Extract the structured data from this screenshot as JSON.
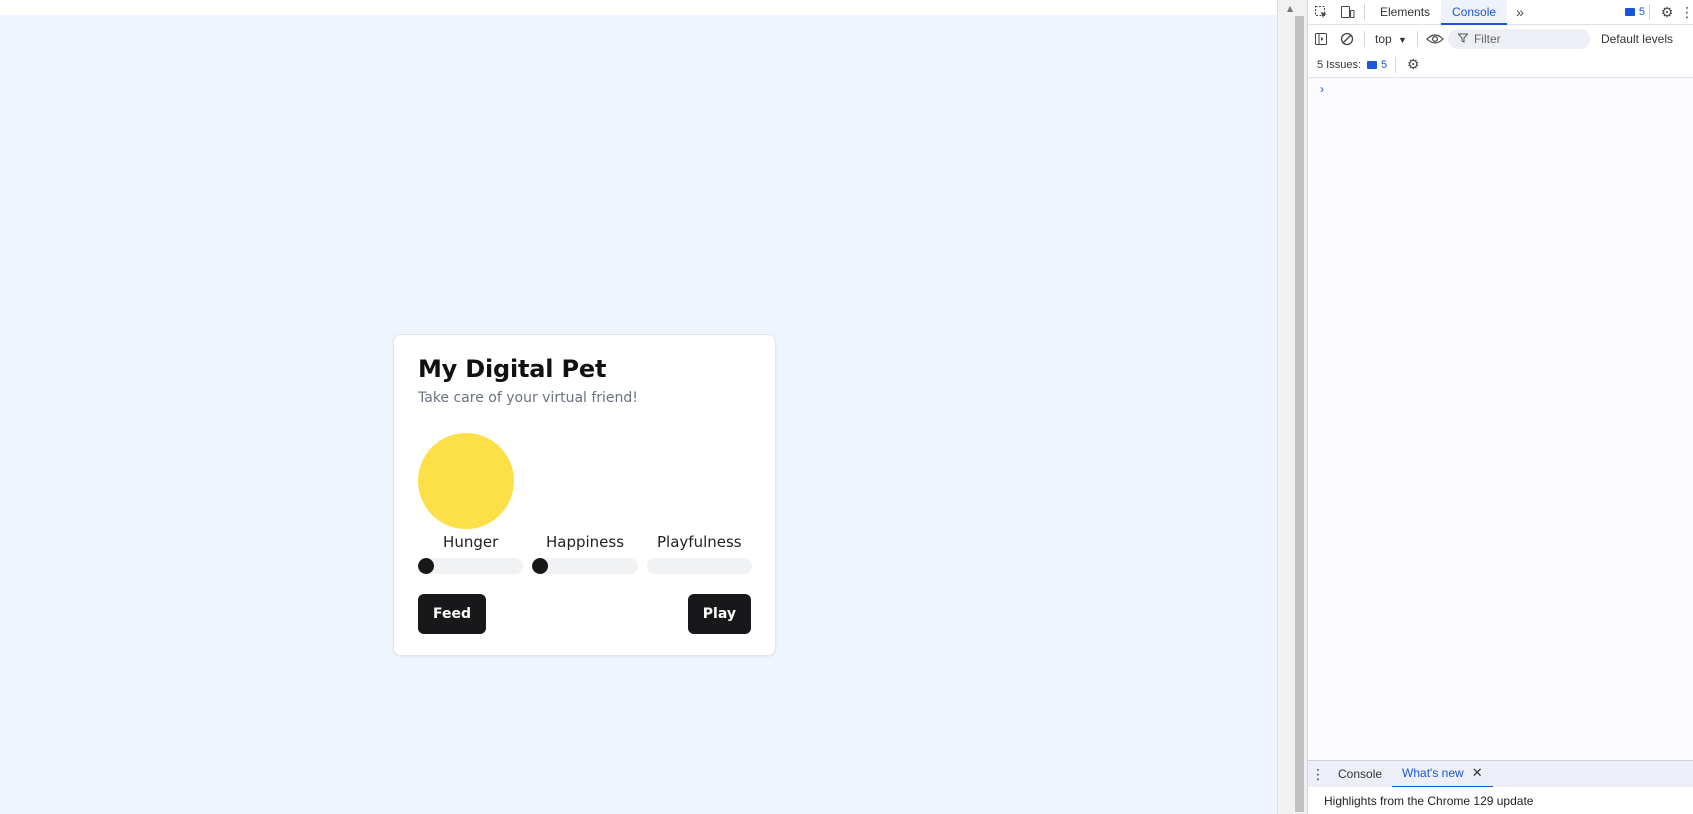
{
  "app": {
    "title": "My Digital Pet",
    "subtitle": "Take care of your virtual friend!",
    "pet_color": "#fde047",
    "stats": [
      {
        "label": "Hunger",
        "value_percent": 15
      },
      {
        "label": "Happiness",
        "value_percent": 15
      },
      {
        "label": "Playfulness",
        "value_percent": 0
      }
    ],
    "buttons": {
      "feed_label": "Feed",
      "play_label": "Play"
    }
  },
  "devtools": {
    "tabs": [
      "Elements",
      "Console"
    ],
    "active_tab": "Console",
    "issues_badge": "5",
    "context": "top",
    "filter_placeholder": "Filter",
    "levels_label": "Default levels",
    "issues_label": "5 Issues:",
    "issues_count": "5",
    "prompt_symbol": "›",
    "drawer": {
      "tabs": [
        "Console",
        "What's new"
      ],
      "active_tab": "What's new",
      "content": "Highlights from the Chrome 129 update"
    },
    "accent_color": "#1a56db"
  }
}
